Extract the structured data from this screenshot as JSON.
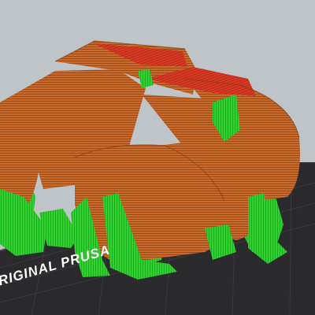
{
  "viewer": {
    "bed_label": "ORIGINAL PRUSA",
    "colors": {
      "background": "#bfc4c9",
      "bed": "#2b2b2e",
      "bed_grid": "#3d3d41",
      "perimeter_orange": "#c96a2a",
      "perimeter_dark": "#9e4f1c",
      "top_solid_red": "#d93a24",
      "support_green": "#2fd12f",
      "support_dark": "#1f9e1f"
    },
    "layers": {
      "part": "perimeters",
      "top": "top-solid-infill",
      "support": "support-material"
    }
  }
}
